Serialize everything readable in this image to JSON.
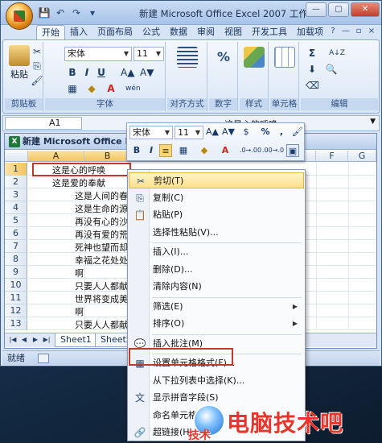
{
  "window": {
    "title": "新建 Microsoft Office Excel 2007 工作...",
    "controls": [
      "—",
      "▢",
      "✕"
    ]
  },
  "qat": [
    "💾",
    "↶",
    "↷",
    "▾"
  ],
  "ribbon": {
    "tabs": [
      "开始",
      "插入",
      "页面布局",
      "公式",
      "数据",
      "审阅",
      "视图",
      "开发工具",
      "加载项"
    ],
    "clipboard": {
      "label": "剪贴板",
      "paste": "粘贴"
    },
    "font": {
      "label": "字体",
      "name": "宋体",
      "size": "11",
      "bold": "B",
      "italic": "I",
      "underline": "U",
      "font_color": "A",
      "phonetic": "wén"
    },
    "alignment": {
      "label": "对齐方式"
    },
    "number": {
      "label": "数字",
      "symbol": "%"
    },
    "styles": {
      "label": "样式"
    },
    "cells": {
      "label": "单元格"
    },
    "editing": {
      "label": "编辑",
      "sum": "Σ",
      "sort": "A↓Z"
    }
  },
  "formula_bar": {
    "name_box": "A1",
    "fx": "fx",
    "value": "这是心的呼唤"
  },
  "workbook": {
    "title": "新建 Microsoft Office Exc",
    "col_heads": [
      "A",
      "B",
      "F",
      "G"
    ],
    "rows": [
      {
        "num": "1",
        "text": "这是心的呼唤"
      },
      {
        "num": "2",
        "text": "这是爱的奉献"
      },
      {
        "num": "3",
        "text": "这是人间的春"
      },
      {
        "num": "4",
        "text": "这是生命的源"
      },
      {
        "num": "5",
        "text": "再没有心的沙"
      },
      {
        "num": "6",
        "text": "再没有爱的荒"
      },
      {
        "num": "7",
        "text": "死神也望而却"
      },
      {
        "num": "8",
        "text": "幸福之花处处"
      },
      {
        "num": "9",
        "text": "啊"
      },
      {
        "num": "10",
        "text": "只要人人都献"
      },
      {
        "num": "11",
        "text": "世界将变成美"
      },
      {
        "num": "12",
        "text": "啊"
      },
      {
        "num": "13",
        "text": "只要人人都献"
      }
    ],
    "sheets": [
      "Sheet1",
      "Sheet2"
    ]
  },
  "status": {
    "text": "就绪"
  },
  "mini_toolbar": {
    "font": "宋体",
    "size": "11",
    "bold": "B",
    "italic": "I",
    "percent": "%",
    "comma": ",",
    "font_color": "A",
    "dec_more": ".0→.00",
    "dec_less": ".00→.0"
  },
  "context_menu": [
    {
      "label": "剪切(T)",
      "icon": "✂",
      "highlight": true
    },
    {
      "label": "复制(C)",
      "icon": "⎘"
    },
    {
      "label": "粘贴(P)",
      "icon": "📋"
    },
    {
      "label": "选择性粘贴(V)..."
    },
    {
      "sep": true
    },
    {
      "label": "插入(I)..."
    },
    {
      "label": "删除(D)..."
    },
    {
      "label": "清除内容(N)"
    },
    {
      "sep": true
    },
    {
      "label": "筛选(E)",
      "arrow": true
    },
    {
      "label": "排序(O)",
      "arrow": true
    },
    {
      "sep": true
    },
    {
      "label": "插入批注(M)",
      "icon": "💬"
    },
    {
      "sep": true
    },
    {
      "label": "设置单元格格式(F)...",
      "icon": "▦"
    },
    {
      "label": "从下拉列表中选择(K)..."
    },
    {
      "label": "显示拼音字段(S)",
      "icon": "文"
    },
    {
      "label": "命名单元格..."
    },
    {
      "label": "超链接(H)...",
      "icon": "🔗"
    }
  ],
  "watermark": {
    "text": "电脑技术吧",
    "sub": "技术"
  }
}
